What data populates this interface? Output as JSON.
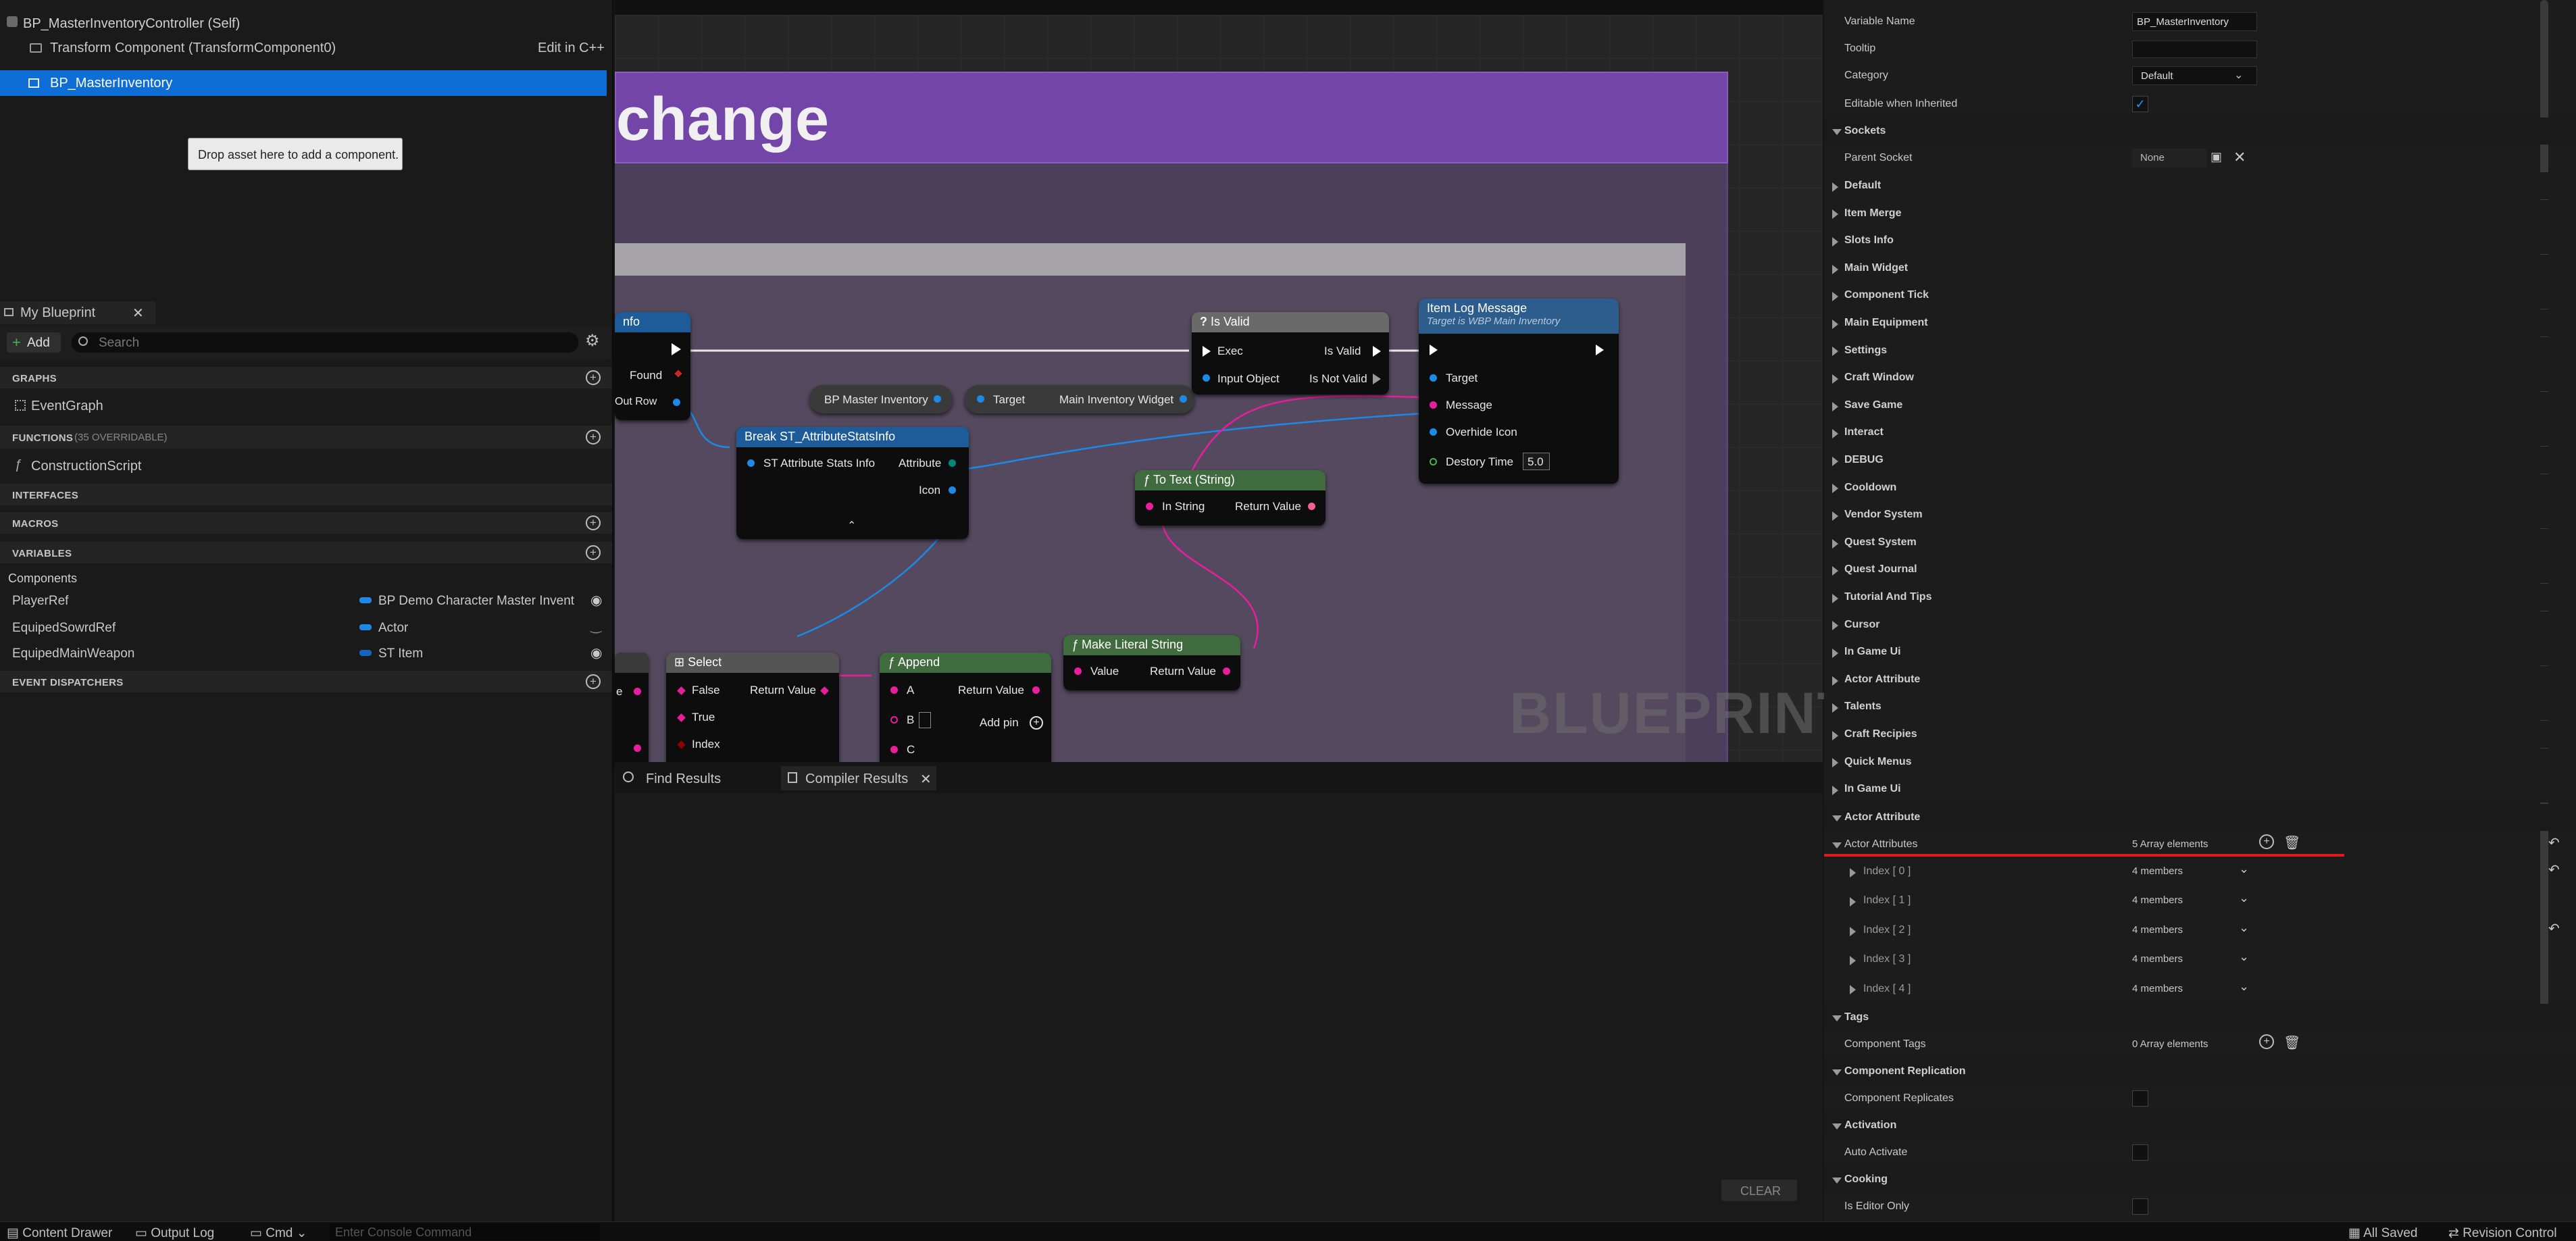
{
  "components": {
    "root_label": "BP_MasterInventoryController (Self)",
    "transform_label": "Transform Component (TransformComponent0)",
    "edit_cpp": "Edit in C++",
    "selected_label": "BP_MasterInventory",
    "drop_hint": "Drop asset here to add a component."
  },
  "my_blueprint": {
    "tab_title": "My Blueprint",
    "add_label": "Add",
    "search_placeholder": "Search",
    "graphs_header": "GRAPHS",
    "event_graph": "EventGraph",
    "functions_header": "FUNCTIONS",
    "functions_count": "(35 OVERRIDABLE)",
    "construction_script": "ConstructionScript",
    "interfaces_header": "INTERFACES",
    "macros_header": "MACROS",
    "variables_header": "VARIABLES",
    "components_group": "Components",
    "variables": [
      {
        "name": "PlayerRef",
        "type": "BP Demo Character Master Invent"
      },
      {
        "name": "EquipedSowrdRef",
        "type": "Actor"
      },
      {
        "name": "EquipedMainWeapon",
        "type": "ST Item"
      }
    ],
    "event_dispatchers_header": "EVENT DISPATCHERS"
  },
  "graph": {
    "widget_title": "change",
    "watermark": "BLUEPRINT",
    "nodes": {
      "info_title": "nfo",
      "found": "Found",
      "out_row": "Out Row",
      "bp_master_inventory": "BP Master Inventory",
      "target": "Target",
      "main_inventory_widget": "Main Inventory Widget",
      "is_valid_title": "Is Valid",
      "exec": "Exec",
      "is_valid": "Is Valid",
      "input_object": "Input Object",
      "is_not_valid": "Is Not Valid",
      "item_log_title": "Item Log Message",
      "item_log_sub": "Target is WBP Main Inventory",
      "item_log_target": "Target",
      "message": "Message",
      "overhide_icon": "Overhide Icon",
      "destory_time": "Destory Time",
      "destory_time_value": "5.0",
      "break_title": "Break ST_AttributeStatsInfo",
      "st_attr_stats_info": "ST Attribute Stats Info",
      "attribute": "Attribute",
      "icon": "Icon",
      "to_text_title": "To Text (String)",
      "in_string": "In String",
      "return_value": "Return Value",
      "select_title": "Select",
      "false": "False",
      "true": "True",
      "index": "Index",
      "append_title": "Append",
      "a": "A",
      "b": "B",
      "c": "C",
      "add_pin": "Add pin",
      "make_literal_title": "Make Literal String",
      "value": "Value",
      "e_stub": "e"
    }
  },
  "bottom_panel": {
    "find_results": "Find Results",
    "compiler_results": "Compiler Results",
    "clear": "CLEAR"
  },
  "details": {
    "variable_name_label": "Variable Name",
    "variable_name_value": "BP_MasterInventory",
    "tooltip_label": "Tooltip",
    "category_label": "Category",
    "category_value": "Default",
    "editable_label": "Editable when Inherited",
    "sockets_header": "Sockets",
    "parent_socket_label": "Parent Socket",
    "parent_socket_value": "None",
    "categories": [
      "Default",
      "Item Merge",
      "Slots Info",
      "Main Widget",
      "Component Tick",
      "Main Equipment",
      "Settings",
      "Craft Window",
      "Save Game",
      "Interact",
      "DEBUG",
      "Cooldown",
      "Vendor System",
      "Quest System",
      "Quest Journal",
      "Tutorial And Tips",
      "Cursor",
      "In Game Ui",
      "Actor Attribute",
      "Talents",
      "Craft Recipies",
      "Quick Menus",
      "In Game Ui"
    ],
    "actor_attribute_header": "Actor Attribute",
    "actor_attributes_label": "Actor Attributes",
    "actor_attributes_value": "5 Array elements",
    "indices": [
      {
        "label": "Index [ 0 ]",
        "value": "4 members"
      },
      {
        "label": "Index [ 1 ]",
        "value": "4 members"
      },
      {
        "label": "Index [ 2 ]",
        "value": "4 members"
      },
      {
        "label": "Index [ 3 ]",
        "value": "4 members"
      },
      {
        "label": "Index [ 4 ]",
        "value": "4 members"
      }
    ],
    "tags_header": "Tags",
    "component_tags_label": "Component Tags",
    "component_tags_value": "0 Array elements",
    "replication_header": "Component Replication",
    "replicates_label": "Component Replicates",
    "activation_header": "Activation",
    "auto_activate_label": "Auto Activate",
    "cooking_header": "Cooking",
    "editor_only_label": "Is Editor Only"
  },
  "statusbar": {
    "content_drawer": "Content Drawer",
    "output_log": "Output Log",
    "cmd": "Cmd",
    "console_placeholder": "Enter Console Command",
    "all_saved": "All Saved",
    "revision_control": "Revision Control"
  }
}
